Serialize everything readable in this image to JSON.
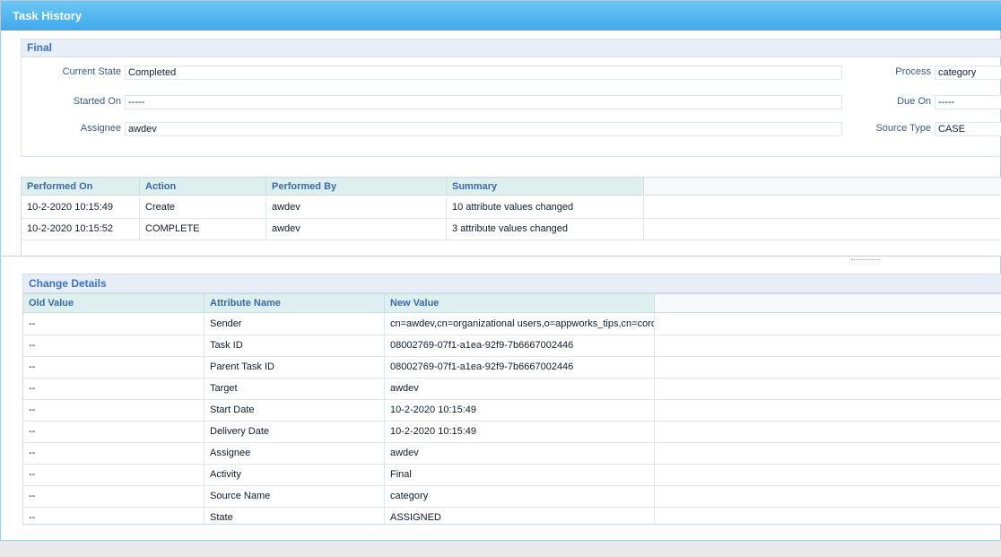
{
  "window": {
    "title": "Task History"
  },
  "final": {
    "header": "Final",
    "current_state_label": "Current State",
    "current_state_value": "Completed",
    "started_on_label": "Started On",
    "started_on_value": "-----",
    "assignee_label": "Assignee",
    "assignee_value": "awdev",
    "process_label": "Process",
    "process_value": "category",
    "due_on_label": "Due On",
    "due_on_value": "-----",
    "source_type_label": "Source Type",
    "source_type_value": "CASE"
  },
  "history": {
    "columns": [
      "Performed On",
      "Action",
      "Performed By",
      "Summary"
    ],
    "rows": [
      [
        "10-2-2020 10:15:49",
        "Create",
        "awdev",
        "10 attribute values changed"
      ],
      [
        "10-2-2020 10:15:52",
        "COMPLETE",
        "awdev",
        "3 attribute values changed"
      ]
    ]
  },
  "change_details": {
    "header": "Change Details",
    "columns": [
      "Old Value",
      "Attribute Name",
      "New Value"
    ],
    "rows": [
      [
        "--",
        "Sender",
        "cn=awdev,cn=organizational users,o=appworks_tips,cn=cordys,cn=defaultInst,o=mydomain.com"
      ],
      [
        "--",
        "Task ID",
        "08002769-07f1-a1ea-92f9-7b6667002446"
      ],
      [
        "--",
        "Parent Task ID",
        "08002769-07f1-a1ea-92f9-7b6667002446"
      ],
      [
        "--",
        "Target",
        "awdev"
      ],
      [
        "--",
        "Start Date",
        "10-2-2020 10:15:49"
      ],
      [
        "--",
        "Delivery Date",
        "10-2-2020 10:15:49"
      ],
      [
        "--",
        "Assignee",
        "awdev"
      ],
      [
        "--",
        "Activity",
        "Final"
      ],
      [
        "--",
        "Source Name",
        "category"
      ],
      [
        "--",
        "State",
        "ASSIGNED"
      ]
    ]
  }
}
